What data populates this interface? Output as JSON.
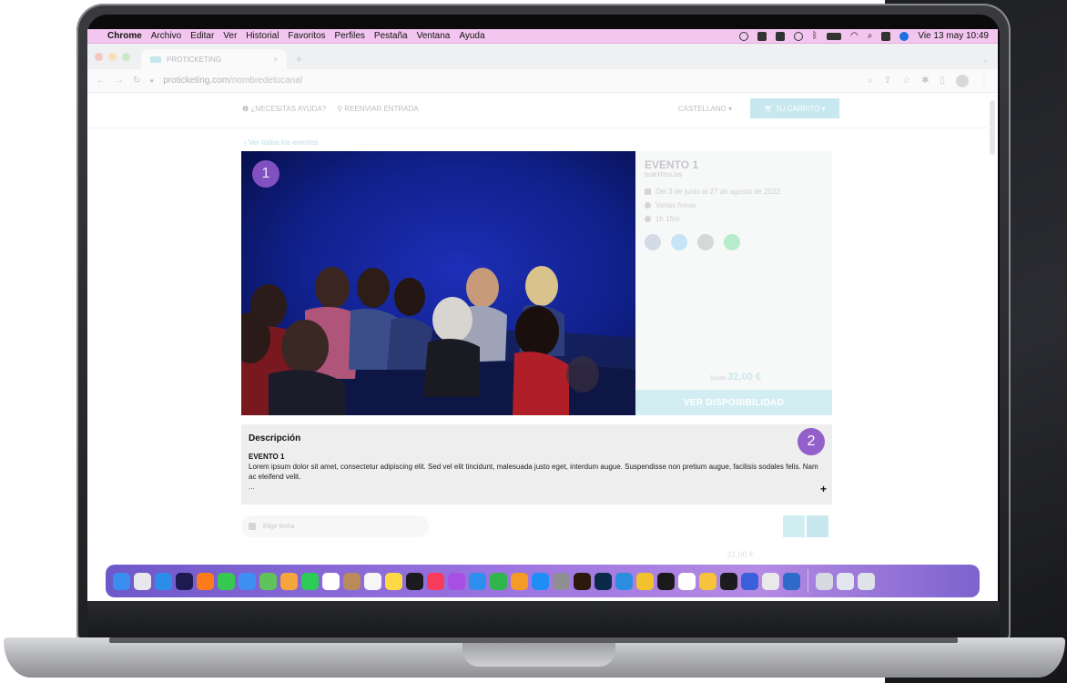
{
  "menubar": {
    "apple": "",
    "app": "Chrome",
    "menus": [
      "Archivo",
      "Editar",
      "Ver",
      "Historial",
      "Favoritos",
      "Perfiles",
      "Pestaña",
      "Ventana",
      "Ayuda"
    ],
    "clock": "Vie 13 may  10:49"
  },
  "browser": {
    "tab_title": "PROTICKETING",
    "tab_close": "×",
    "new_tab": "+",
    "tab_chevron": "⌄",
    "url_domain": "proticketing.com",
    "url_path": "/nombredetucanal"
  },
  "site": {
    "help": "¿NECESITAS AYUDA?",
    "resend": "REENVIAR ENTRADA",
    "language": "CASTELLANO",
    "cart": "TU CARRITO",
    "back_link": "‹ Ver todos los eventos"
  },
  "event": {
    "title": "EVENTO 1",
    "subtitle": "SUBTÍTULOS",
    "dates": "Del 3 de junio al 27 de agosto de 2022",
    "times": "Varias horas",
    "duration": "1h 15m",
    "from_label": "Desde",
    "price": "32,00 €",
    "availability_button": "VER DISPONIBILIDAD"
  },
  "badges": {
    "one": "1",
    "two": "2"
  },
  "description": {
    "heading": "Descripción",
    "event_name": "EVENTO 1",
    "text": "Lorem ipsum dolor sit amet, consectetur adipiscing elit. Sed vel elit tincidunt, malesuada justo eget, interdum augue. Suspendisse non pretium augue, facilisis sodales felis. Nam ac eleifend velit.",
    "ellipsis": "...",
    "expand": "+"
  },
  "date_picker": {
    "placeholder": "Elige fecha"
  },
  "ghost_price": "32,00 €",
  "colors": {
    "accent": "#c7e8ee",
    "badge": "#8c55c9",
    "menubar": "#f3c6ef",
    "facebook": "#3b5998",
    "twitter": "#1da1f2",
    "email": "#444444",
    "whatsapp": "#25d366"
  },
  "dock": {
    "apps": [
      {
        "name": "finder-icon",
        "color": "#3a8ef0"
      },
      {
        "name": "launchpad-icon",
        "color": "#e8e8ec"
      },
      {
        "name": "safari-icon",
        "color": "#2b8de8"
      },
      {
        "name": "after-effects-icon",
        "color": "#1d1a52"
      },
      {
        "name": "firefox-icon",
        "color": "#ff7a1a"
      },
      {
        "name": "messages-icon",
        "color": "#37c850"
      },
      {
        "name": "mail-icon",
        "color": "#3d8ff2"
      },
      {
        "name": "maps-icon",
        "color": "#5fc25a"
      },
      {
        "name": "photos-icon",
        "color": "#f4a53b"
      },
      {
        "name": "facetime-icon",
        "color": "#2fcb57"
      },
      {
        "name": "calendar-icon",
        "color": "#ffffff"
      },
      {
        "name": "contacts-icon",
        "color": "#b98b5a"
      },
      {
        "name": "reminders-icon",
        "color": "#f6f6f6"
      },
      {
        "name": "notes-icon",
        "color": "#ffd845"
      },
      {
        "name": "tv-icon",
        "color": "#1b1b1f"
      },
      {
        "name": "music-icon",
        "color": "#fa3c5c"
      },
      {
        "name": "podcasts-icon",
        "color": "#a650e6"
      },
      {
        "name": "keynote-icon",
        "color": "#2d8ef0"
      },
      {
        "name": "numbers-icon",
        "color": "#2fb54a"
      },
      {
        "name": "pages-icon",
        "color": "#f59a26"
      },
      {
        "name": "app-store-icon",
        "color": "#1e8ef5"
      },
      {
        "name": "system-preferences-icon",
        "color": "#8e8e93"
      },
      {
        "name": "illustrator-icon",
        "color": "#2b1a0b"
      },
      {
        "name": "photoshop-icon",
        "color": "#0b2a4a"
      },
      {
        "name": "vscode-icon",
        "color": "#2b8de0"
      },
      {
        "name": "chrome-icon",
        "color": "#f2c12e"
      },
      {
        "name": "terminal-icon",
        "color": "#1a1a1a"
      },
      {
        "name": "slack-icon",
        "color": "#ffffff"
      },
      {
        "name": "folder-app-icon",
        "color": "#f6c33b"
      },
      {
        "name": "x-app-icon",
        "color": "#1c1c1f"
      },
      {
        "name": "separator-app-icon",
        "color": "#3a5fd9"
      },
      {
        "name": "font-book-icon",
        "color": "#e9e9ec"
      },
      {
        "name": "quicktime-icon",
        "color": "#2e6ac8"
      }
    ],
    "trailing": [
      {
        "name": "downloads-stack-icon",
        "color": "#d7d9e0"
      },
      {
        "name": "documents-stack-icon",
        "color": "#e3e6ee"
      },
      {
        "name": "trash-icon",
        "color": "#dfe2e8"
      }
    ]
  }
}
